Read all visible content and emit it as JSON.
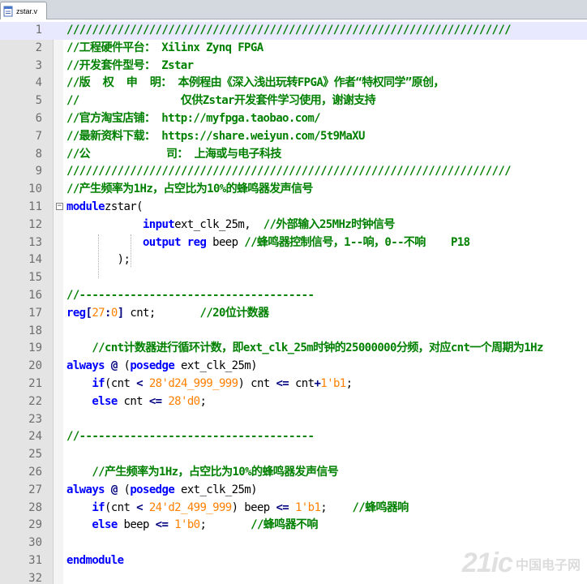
{
  "tab": {
    "filename": "zstar.v",
    "icon": "file-icon"
  },
  "lines": [
    {
      "n": "1",
      "segs": [
        [
          "cm",
          "//////////////////////////////////////////////////////////////////////"
        ]
      ]
    },
    {
      "n": "2",
      "segs": [
        [
          "cm",
          "//工程硬件平台： Xilinx Zynq FPGA"
        ]
      ]
    },
    {
      "n": "3",
      "segs": [
        [
          "cm",
          "//开发套件型号： Zstar"
        ]
      ]
    },
    {
      "n": "4",
      "segs": [
        [
          "cm",
          "//版  权  申  明： 本例程由《深入浅出玩转FPGA》作者“特权同学”原创，"
        ]
      ]
    },
    {
      "n": "5",
      "segs": [
        [
          "cm",
          "//                仅供Zstar开发套件学习使用，谢谢支持"
        ]
      ]
    },
    {
      "n": "6",
      "segs": [
        [
          "cm",
          "//官方淘宝店铺： http://myfpga.taobao.com/"
        ]
      ]
    },
    {
      "n": "7",
      "segs": [
        [
          "cm",
          "//最新资料下载： https://share.weiyun.com/5t9MaXU"
        ]
      ]
    },
    {
      "n": "8",
      "segs": [
        [
          "cm",
          "//公            司： 上海或与电子科技"
        ]
      ]
    },
    {
      "n": "9",
      "segs": [
        [
          "cm",
          "//////////////////////////////////////////////////////////////////////"
        ]
      ]
    },
    {
      "n": "10",
      "segs": [
        [
          "cm",
          "//产生频率为1Hz，占空比为10%的蜂鸣器发声信号"
        ]
      ]
    },
    {
      "n": "11",
      "fold": true,
      "segs": [
        [
          "kw",
          "module"
        ],
        [
          "",
          "zstar("
        ]
      ]
    },
    {
      "n": "12",
      "segs": [
        [
          "",
          "            "
        ],
        [
          "kw",
          "input"
        ],
        [
          "",
          "ext_clk_25m,  "
        ],
        [
          "cm",
          "//外部输入25MHz时钟信号"
        ]
      ]
    },
    {
      "n": "13",
      "segs": [
        [
          "",
          "            "
        ],
        [
          "kw",
          "output"
        ],
        [
          "",
          " "
        ],
        [
          "kw",
          "reg"
        ],
        [
          "",
          " beep "
        ],
        [
          "cm",
          "//蜂鸣器控制信号，1--响，0--不响    P18"
        ]
      ]
    },
    {
      "n": "14",
      "segs": [
        [
          "",
          "        );"
        ]
      ]
    },
    {
      "n": "15",
      "segs": [
        [
          "",
          ""
        ]
      ]
    },
    {
      "n": "16",
      "segs": [
        [
          "cm",
          "//-------------------------------------"
        ]
      ]
    },
    {
      "n": "17",
      "segs": [
        [
          "kw",
          "reg"
        ],
        [
          "op",
          "["
        ],
        [
          "num",
          "27"
        ],
        [
          "op",
          ":"
        ],
        [
          "num",
          "0"
        ],
        [
          "op",
          "]"
        ],
        [
          "",
          " cnt;       "
        ],
        [
          "cm",
          "//20位计数器"
        ]
      ]
    },
    {
      "n": "18",
      "segs": [
        [
          "",
          ""
        ]
      ]
    },
    {
      "n": "19",
      "segs": [
        [
          "",
          "    "
        ],
        [
          "cm",
          "//cnt计数器进行循环计数，即ext_clk_25m时钟的25000000分频，对应cnt一个周期为1Hz"
        ]
      ]
    },
    {
      "n": "20",
      "segs": [
        [
          "kw",
          "always"
        ],
        [
          "",
          " "
        ],
        [
          "op",
          "@"
        ],
        [
          "",
          " ("
        ],
        [
          "kw",
          "posedge"
        ],
        [
          "",
          " ext_clk_25m)"
        ]
      ]
    },
    {
      "n": "21",
      "segs": [
        [
          "",
          "    "
        ],
        [
          "kw",
          "if"
        ],
        [
          "",
          "(cnt "
        ],
        [
          "op",
          "<"
        ],
        [
          "",
          " "
        ],
        [
          "num",
          "28'd24_999_999"
        ],
        [
          "",
          ") cnt "
        ],
        [
          "op",
          "<="
        ],
        [
          "",
          " cnt"
        ],
        [
          "op",
          "+"
        ],
        [
          "num",
          "1'b1"
        ],
        [
          "",
          ";"
        ]
      ]
    },
    {
      "n": "22",
      "segs": [
        [
          "",
          "    "
        ],
        [
          "kw",
          "else"
        ],
        [
          "",
          " cnt "
        ],
        [
          "op",
          "<="
        ],
        [
          "",
          " "
        ],
        [
          "num",
          "28'd0"
        ],
        [
          "",
          ";"
        ]
      ]
    },
    {
      "n": "23",
      "segs": [
        [
          "",
          ""
        ]
      ]
    },
    {
      "n": "24",
      "segs": [
        [
          "cm",
          "//-------------------------------------"
        ]
      ]
    },
    {
      "n": "25",
      "segs": [
        [
          "",
          ""
        ]
      ]
    },
    {
      "n": "26",
      "segs": [
        [
          "",
          "    "
        ],
        [
          "cm",
          "//产生频率为1Hz，占空比为10%的蜂鸣器发声信号"
        ]
      ]
    },
    {
      "n": "27",
      "segs": [
        [
          "kw",
          "always"
        ],
        [
          "",
          " "
        ],
        [
          "op",
          "@"
        ],
        [
          "",
          " ("
        ],
        [
          "kw",
          "posedge"
        ],
        [
          "",
          " ext_clk_25m)"
        ]
      ]
    },
    {
      "n": "28",
      "segs": [
        [
          "",
          "    "
        ],
        [
          "kw",
          "if"
        ],
        [
          "",
          "(cnt "
        ],
        [
          "op",
          "<"
        ],
        [
          "",
          " "
        ],
        [
          "num",
          "24'd2_499_999"
        ],
        [
          "",
          ") beep "
        ],
        [
          "op",
          "<="
        ],
        [
          "",
          " "
        ],
        [
          "num",
          "1'b1"
        ],
        [
          "",
          ";    "
        ],
        [
          "cm",
          "//蜂鸣器响"
        ]
      ]
    },
    {
      "n": "29",
      "segs": [
        [
          "",
          "    "
        ],
        [
          "kw",
          "else"
        ],
        [
          "",
          " beep "
        ],
        [
          "op",
          "<="
        ],
        [
          "",
          " "
        ],
        [
          "num",
          "1'b0"
        ],
        [
          "",
          ";       "
        ],
        [
          "cm",
          "//蜂鸣器不响"
        ]
      ]
    },
    {
      "n": "30",
      "segs": [
        [
          "",
          ""
        ]
      ]
    },
    {
      "n": "31",
      "segs": [
        [
          "kw",
          "endmodule"
        ]
      ]
    },
    {
      "n": "32",
      "segs": [
        [
          "",
          ""
        ]
      ]
    }
  ],
  "watermark": {
    "main": "21ic",
    "sub": "中国电子网"
  }
}
